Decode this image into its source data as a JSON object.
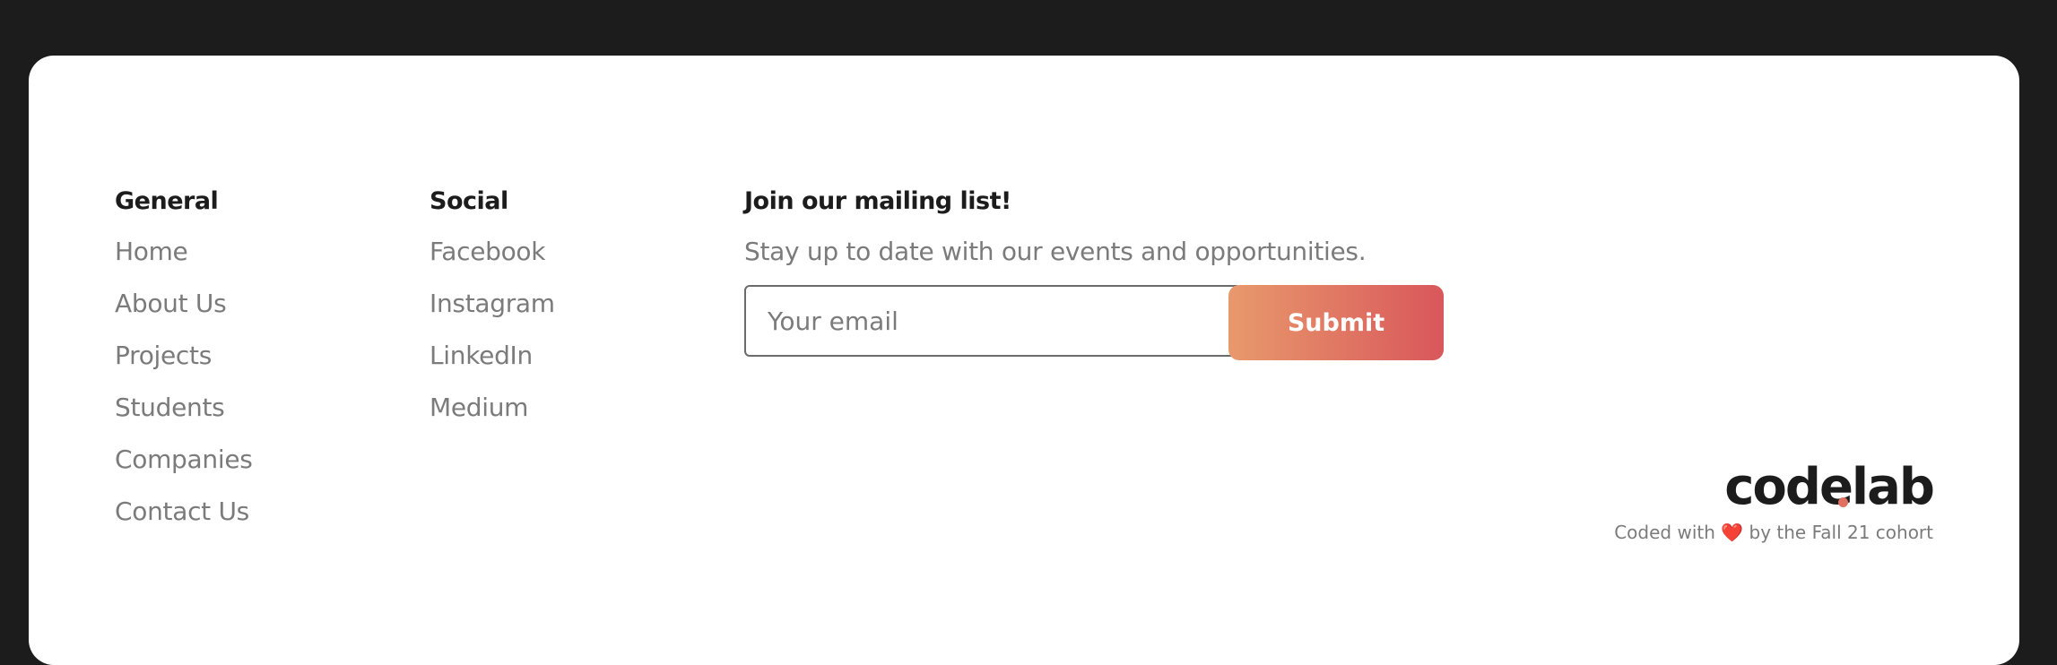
{
  "general": {
    "heading": "General",
    "links": [
      "Home",
      "About Us",
      "Projects",
      "Students",
      "Companies",
      "Contact Us"
    ]
  },
  "social": {
    "heading": "Social",
    "links": [
      "Facebook",
      "Instagram",
      "LinkedIn",
      "Medium"
    ]
  },
  "mailing": {
    "heading": "Join our mailing list!",
    "description": "Stay up to date with our events and opportunities.",
    "email_placeholder": "Your email",
    "email_value": "",
    "submit_label": "Submit"
  },
  "brand": {
    "logo_text": "codelab",
    "credit_prefix": "Coded with",
    "heart_icon": "heart-icon",
    "heart_glyph": "❤️",
    "credit_suffix": "by the Fall 21 cohort"
  },
  "colors": {
    "page_bg": "#1c1c1c",
    "card_bg": "#ffffff",
    "link_gray": "#7b7b7b",
    "gradient_start": "#e8996c",
    "gradient_end": "#d9575b",
    "logo_dot": "#e0705f"
  }
}
